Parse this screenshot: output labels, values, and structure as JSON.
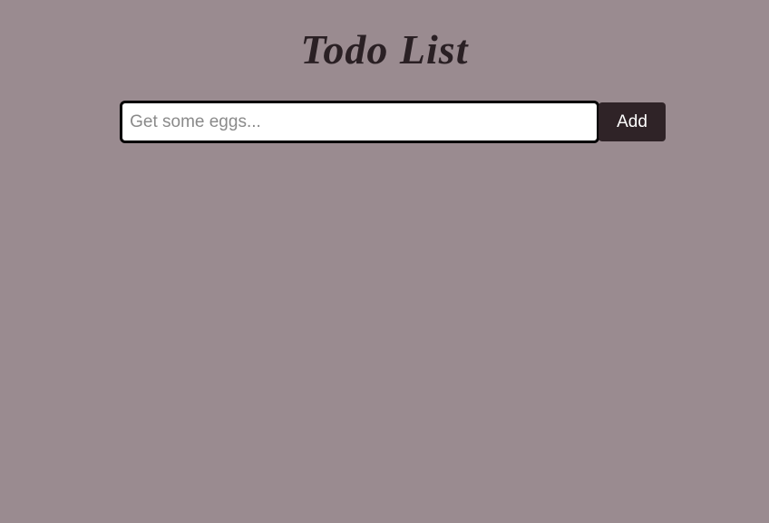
{
  "header": {
    "title": "Todo List"
  },
  "form": {
    "input_value": "",
    "input_placeholder": "Get some eggs...",
    "add_button_label": "Add"
  },
  "colors": {
    "background": "#9a8b90",
    "button_bg": "#2f2327",
    "title_color": "#2a2024"
  }
}
